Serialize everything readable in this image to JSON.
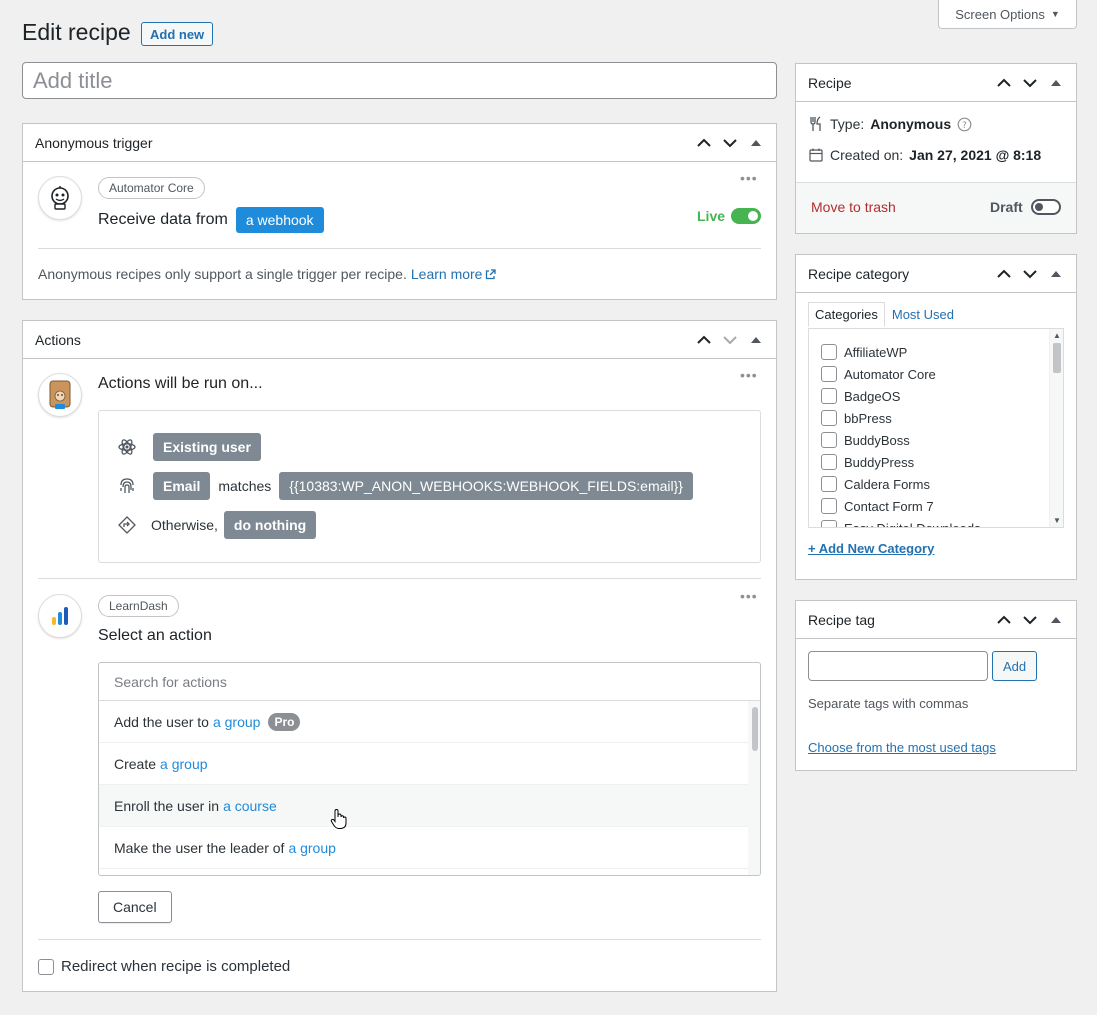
{
  "screen_options": {
    "label": "Screen Options"
  },
  "header": {
    "title": "Edit recipe",
    "add_new": "Add new"
  },
  "title_input": {
    "placeholder": "Add title"
  },
  "trigger_box": {
    "title": "Anonymous trigger",
    "integration": "Automator Core",
    "sentence_prefix": "Receive data from",
    "token": "a webhook",
    "status": "Live",
    "note": "Anonymous recipes only support a single trigger per recipe.",
    "learn_more": "Learn more"
  },
  "actions_box": {
    "title": "Actions",
    "run_on_label": "Actions will be run on...",
    "conditions": {
      "existing_user": "Existing user",
      "email": "Email",
      "matches": "matches",
      "email_token": "{{10383:WP_ANON_WEBHOOKS:WEBHOOK_FIELDS:email}}",
      "otherwise": "Otherwise,",
      "do_nothing": "do nothing"
    },
    "action_integration": "LearnDash",
    "select_action_label": "Select an action",
    "search_placeholder": "Search for actions",
    "options": [
      {
        "text": "Add the user to",
        "token": "a group",
        "badge": "Pro"
      },
      {
        "text": "Create",
        "token": "a group"
      },
      {
        "text": "Enroll the user in",
        "token": "a course"
      },
      {
        "text": "Make the user the leader of",
        "token": "a group"
      }
    ],
    "cancel": "Cancel",
    "redirect_label": "Redirect when recipe is completed"
  },
  "recipe_box": {
    "title": "Recipe",
    "type_label": "Type:",
    "type_value": "Anonymous",
    "created_label": "Created on:",
    "created_value": "Jan 27, 2021 @ 8:18",
    "trash": "Move to trash",
    "status": "Draft"
  },
  "category_box": {
    "title": "Recipe category",
    "tab_categories": "Categories",
    "tab_most_used": "Most Used",
    "items": [
      "AffiliateWP",
      "Automator Core",
      "BadgeOS",
      "bbPress",
      "BuddyBoss",
      "BuddyPress",
      "Caldera Forms",
      "Contact Form 7",
      "Easy Digital Downloads"
    ],
    "add_new": "+ Add New Category"
  },
  "tag_box": {
    "title": "Recipe tag",
    "add": "Add",
    "hint": "Separate tags with commas",
    "choose": "Choose from the most used tags"
  },
  "colors": {
    "accent": "#2271b1",
    "token_blue": "#1e8cdb",
    "live_green": "#46b450",
    "trash_red": "#b32d2e",
    "token_gray": "#7e8993"
  }
}
